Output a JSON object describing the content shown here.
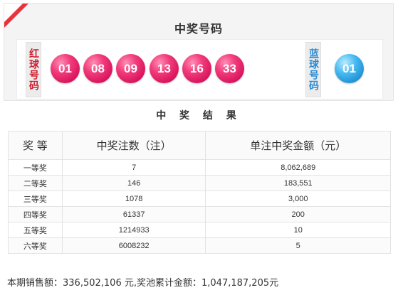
{
  "header": {
    "title": "中奖号码",
    "red_label": "红球号码",
    "blue_label": "蓝球号码"
  },
  "red_balls": [
    "01",
    "08",
    "09",
    "13",
    "16",
    "33"
  ],
  "blue_ball": "01",
  "results": {
    "title": "中 奖 结 果",
    "columns": [
      "奖 等",
      "中奖注数（注）",
      "单注中奖金额（元）"
    ],
    "rows": [
      {
        "level": "一等奖",
        "count": "7",
        "amount": "8,062,689"
      },
      {
        "level": "二等奖",
        "count": "146",
        "amount": "183,551"
      },
      {
        "level": "三等奖",
        "count": "1078",
        "amount": "3,000"
      },
      {
        "level": "四等奖",
        "count": "61337",
        "amount": "200"
      },
      {
        "level": "五等奖",
        "count": "1214933",
        "amount": "10"
      },
      {
        "level": "六等奖",
        "count": "6008232",
        "amount": "5"
      }
    ]
  },
  "footer": {
    "sales_label": "本期销售额：",
    "sales_value": "336,502,106 元",
    "pool_label": ",奖池累计金额：",
    "pool_value": "1,047,187,205元"
  },
  "colors": {
    "accent_red": "#e8323c",
    "red_ball": "#e0185f",
    "blue_ball": "#2a9ad8"
  }
}
